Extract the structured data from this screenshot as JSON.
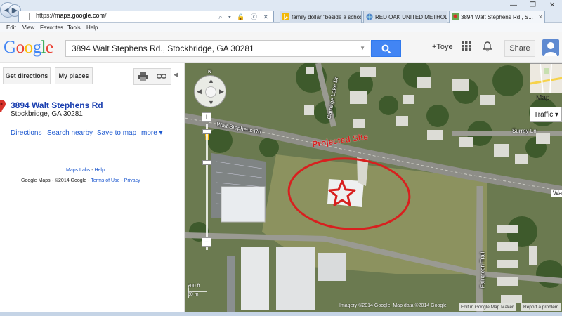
{
  "browser": {
    "back_glyph": "◀",
    "forward_glyph": "▶",
    "url_scheme": "https://",
    "url_host": "maps.google.com",
    "url_path": "/",
    "address_icons": "⌕ ▾ 🔒 ⓒ ✕",
    "tabs": [
      {
        "label": "family dollar \"beside a schoo...",
        "icon": "bing-icon"
      },
      {
        "label": "RED OAK UNITED METHODI...",
        "icon": "globe-icon"
      },
      {
        "label": "3894 Walt Stephens Rd., S...",
        "icon": "google-maps-icon"
      }
    ],
    "tab_close": "×",
    "window_controls": [
      "—",
      "❐",
      "✕"
    ]
  },
  "menu": [
    "Edit",
    "View",
    "Favorites",
    "Tools",
    "Help"
  ],
  "header": {
    "logo_letters": [
      {
        "char": "G",
        "color": "#4285f4"
      },
      {
        "char": "o",
        "color": "#ea4335"
      },
      {
        "char": "o",
        "color": "#fbbc05"
      },
      {
        "char": "g",
        "color": "#4285f4"
      },
      {
        "char": "l",
        "color": "#34a853"
      },
      {
        "char": "e",
        "color": "#ea4335"
      }
    ],
    "search_value": "3894 Walt Stephens Rd., Stockbridge, GA 30281",
    "search_dropdown": "▼",
    "user_link": "+Toye",
    "share_label": "Share"
  },
  "left_panel": {
    "get_directions": "Get directions",
    "my_places": "My places",
    "collapse": "◀",
    "place_title": "3894 Walt Stephens Rd",
    "place_address": "Stockbridge, GA 30281",
    "links": {
      "directions": "Directions",
      "search_nearby": "Search nearby",
      "save_to_map": "Save to map",
      "more": "more ▾"
    },
    "footer": {
      "maps_labs": "Maps Labs",
      "help": "Help",
      "sep": " - ",
      "google_maps": "Google Maps",
      "copyright": "©2014 Google",
      "terms": "Terms of Use",
      "privacy": "Privacy"
    }
  },
  "map": {
    "nav_north": "N",
    "zoom_in": "+",
    "zoom_out": "−",
    "road_labels": {
      "walt_stephens": "Walt Stephens Rd",
      "carriage_lake": "Carriage Lake Dr",
      "surrey_ln": "Surrey Ln",
      "fairgreen_trail": "Fairgreen Trail",
      "wa": "Wa"
    },
    "annotation": "Projected Site",
    "map_type": "Map",
    "traffic": "Traffic ▾",
    "scale_top": "200 ft",
    "scale_bottom": "50 m",
    "attribution": "Imagery ©2014 Google, Map data ©2014 Google",
    "edit_link": "Edit in Google Map Maker",
    "report_link": "Report a problem",
    "annotation_color": "#d8201f"
  }
}
